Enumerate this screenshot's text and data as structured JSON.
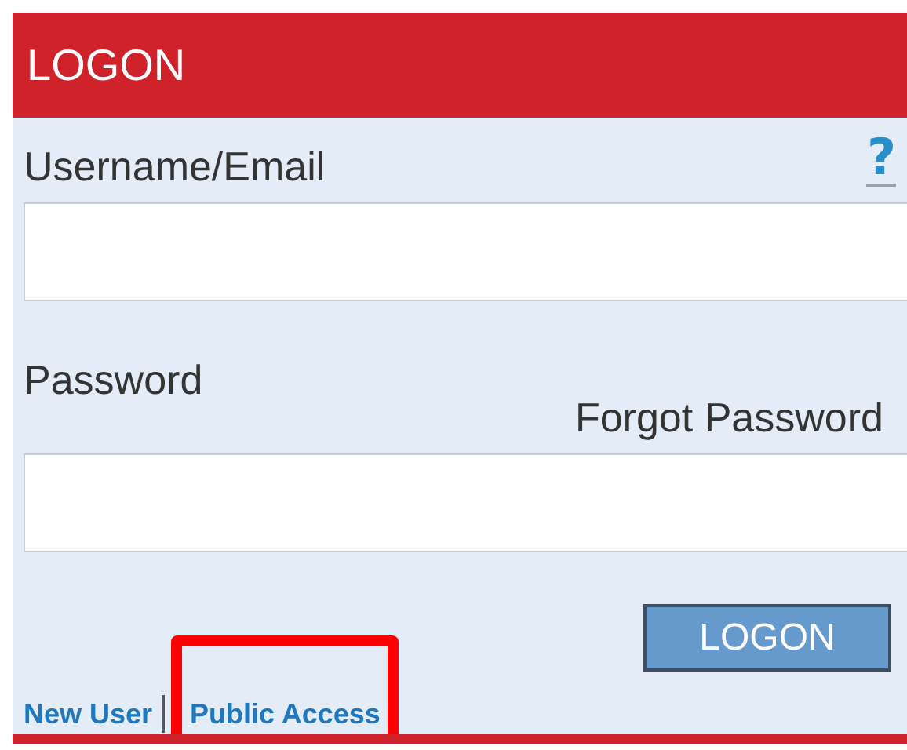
{
  "header": {
    "title": "LOGON"
  },
  "username": {
    "label": "Username/Email",
    "help": "?"
  },
  "password": {
    "label": "Password",
    "forgot_link": "Forgot Password"
  },
  "submit_button": "LOGON",
  "links": [
    {
      "label": "New User",
      "highlighted": false
    },
    {
      "label": "Public Access",
      "highlighted": true
    }
  ]
}
